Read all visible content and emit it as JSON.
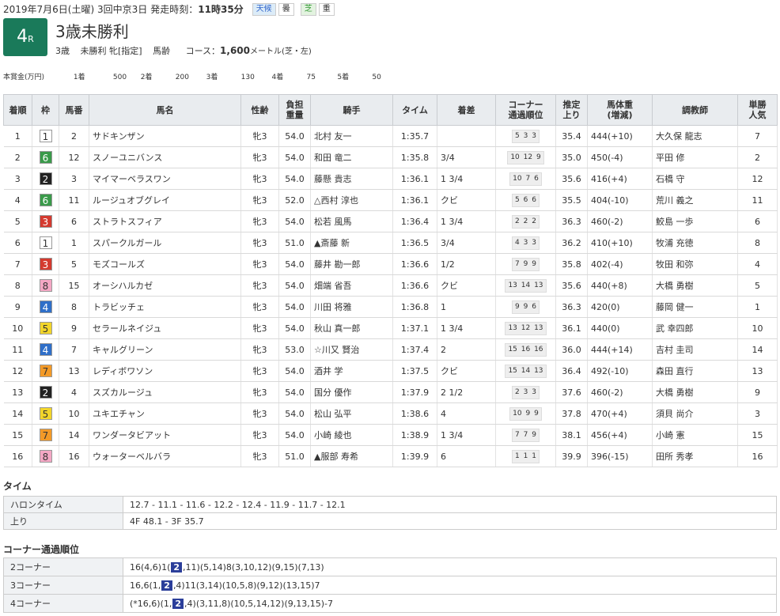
{
  "header": {
    "date": "2019年7月6日(土曜) 3回中京3日",
    "post_time_label": "発走時刻：",
    "post_time": "11時35分",
    "weather_label": "天候",
    "weather": "曇",
    "track_label": "芝",
    "track": "重"
  },
  "race": {
    "number": "4",
    "number_suffix": "R",
    "name": "3歳未勝利",
    "conditions": [
      "3歳",
      "未勝利 牝[指定]",
      "馬齢"
    ],
    "course_prefix": "コース：",
    "course_distance": "1,600",
    "course_suffix": "メートル(芝・左)"
  },
  "prize": {
    "label": "本賞金(万円)",
    "items": [
      {
        "place": "1着",
        "amount": "500"
      },
      {
        "place": "2着",
        "amount": "200"
      },
      {
        "place": "3着",
        "amount": "130"
      },
      {
        "place": "4着",
        "amount": "75"
      },
      {
        "place": "5着",
        "amount": "50"
      }
    ]
  },
  "columns": [
    "着順",
    "枠",
    "馬番",
    "馬名",
    "性齢",
    "負担\n重量",
    "騎手",
    "タイム",
    "着差",
    "コーナー\n通過順位",
    "推定\n上り",
    "馬体重\n(増減)",
    "調教師",
    "単勝\n人気"
  ],
  "waku_colors": {
    "1": {
      "bg": "#ffffff",
      "fg": "#333333"
    },
    "2": {
      "bg": "#222222",
      "fg": "#ffffff"
    },
    "3": {
      "bg": "#d43a2f",
      "fg": "#ffffff"
    },
    "4": {
      "bg": "#2f6fc8",
      "fg": "#ffffff"
    },
    "5": {
      "bg": "#f2d52a",
      "fg": "#333333"
    },
    "6": {
      "bg": "#3a9a4a",
      "fg": "#ffffff"
    },
    "7": {
      "bg": "#f39a28",
      "fg": "#333333"
    },
    "8": {
      "bg": "#f4a7c4",
      "fg": "#333333"
    }
  },
  "results": [
    {
      "rank": "1",
      "waku": "1",
      "num": "2",
      "horse": "サドキンザン",
      "sex_age": "牝3",
      "weight": "54.0",
      "jockey": "北村 友一",
      "time": "1:35.7",
      "margin": "",
      "corner": "5 3 3",
      "last3f": "35.4",
      "body": "444(+10)",
      "trainer": "大久保 龍志",
      "pop": "7"
    },
    {
      "rank": "2",
      "waku": "6",
      "num": "12",
      "horse": "スノーユニバンス",
      "sex_age": "牝3",
      "weight": "54.0",
      "jockey": "和田 竜二",
      "time": "1:35.8",
      "margin": "3/4",
      "corner": "10 12 9",
      "last3f": "35.0",
      "body": "450(-4)",
      "trainer": "平田 修",
      "pop": "2"
    },
    {
      "rank": "3",
      "waku": "2",
      "num": "3",
      "horse": "マイマーベラスワン",
      "sex_age": "牝3",
      "weight": "54.0",
      "jockey": "藤懸 貴志",
      "time": "1:36.1",
      "margin": "1 3/4",
      "corner": "10 7 6",
      "last3f": "35.6",
      "body": "416(+4)",
      "trainer": "石橋 守",
      "pop": "12"
    },
    {
      "rank": "4",
      "waku": "6",
      "num": "11",
      "horse": "ルージュオブグレイ",
      "sex_age": "牝3",
      "weight": "52.0",
      "jockey": "△西村 淳也",
      "time": "1:36.1",
      "margin": "クビ",
      "corner": "5 6 6",
      "last3f": "35.5",
      "body": "404(-10)",
      "trainer": "荒川 義之",
      "pop": "11"
    },
    {
      "rank": "5",
      "waku": "3",
      "num": "6",
      "horse": "ストラトスフィア",
      "sex_age": "牝3",
      "weight": "54.0",
      "jockey": "松若 風馬",
      "time": "1:36.4",
      "margin": "1 3/4",
      "corner": "2 2 2",
      "last3f": "36.3",
      "body": "460(-2)",
      "trainer": "鮫島 一歩",
      "pop": "6"
    },
    {
      "rank": "6",
      "waku": "1",
      "num": "1",
      "horse": "スパークルガール",
      "sex_age": "牝3",
      "weight": "51.0",
      "jockey": "▲斎藤 新",
      "time": "1:36.5",
      "margin": "3/4",
      "corner": "4 3 3",
      "last3f": "36.2",
      "body": "410(+10)",
      "trainer": "牧浦 充徳",
      "pop": "8"
    },
    {
      "rank": "7",
      "waku": "3",
      "num": "5",
      "horse": "モズコールズ",
      "sex_age": "牝3",
      "weight": "54.0",
      "jockey": "藤井 勘一郎",
      "time": "1:36.6",
      "margin": "1/2",
      "corner": "7 9 9",
      "last3f": "35.8",
      "body": "402(-4)",
      "trainer": "牧田 和弥",
      "pop": "4"
    },
    {
      "rank": "8",
      "waku": "8",
      "num": "15",
      "horse": "オーシハルカゼ",
      "sex_age": "牝3",
      "weight": "54.0",
      "jockey": "畑端 省吾",
      "time": "1:36.6",
      "margin": "クビ",
      "corner": "13 14 13",
      "last3f": "35.6",
      "body": "440(+8)",
      "trainer": "大橋 勇樹",
      "pop": "5"
    },
    {
      "rank": "9",
      "waku": "4",
      "num": "8",
      "horse": "トラビッチェ",
      "sex_age": "牝3",
      "weight": "54.0",
      "jockey": "川田 将雅",
      "time": "1:36.8",
      "margin": "1",
      "corner": "9 9 6",
      "last3f": "36.3",
      "body": "420(0)",
      "trainer": "藤岡 健一",
      "pop": "1"
    },
    {
      "rank": "10",
      "waku": "5",
      "num": "9",
      "horse": "セラールネイジュ",
      "sex_age": "牝3",
      "weight": "54.0",
      "jockey": "秋山 真一郎",
      "time": "1:37.1",
      "margin": "1 3/4",
      "corner": "13 12 13",
      "last3f": "36.1",
      "body": "440(0)",
      "trainer": "武 幸四郎",
      "pop": "10"
    },
    {
      "rank": "11",
      "waku": "4",
      "num": "7",
      "horse": "キャルグリーン",
      "sex_age": "牝3",
      "weight": "53.0",
      "jockey": "☆川又 賢治",
      "time": "1:37.4",
      "margin": "2",
      "corner": "15 16 16",
      "last3f": "36.0",
      "body": "444(+14)",
      "trainer": "吉村 圭司",
      "pop": "14"
    },
    {
      "rank": "12",
      "waku": "7",
      "num": "13",
      "horse": "レディボワソン",
      "sex_age": "牝3",
      "weight": "54.0",
      "jockey": "酒井 学",
      "time": "1:37.5",
      "margin": "クビ",
      "corner": "15 14 13",
      "last3f": "36.4",
      "body": "492(-10)",
      "trainer": "森田 直行",
      "pop": "13"
    },
    {
      "rank": "13",
      "waku": "2",
      "num": "4",
      "horse": "スズカルージュ",
      "sex_age": "牝3",
      "weight": "54.0",
      "jockey": "国分 優作",
      "time": "1:37.9",
      "margin": "2 1/2",
      "corner": "2 3 3",
      "last3f": "37.6",
      "body": "460(-2)",
      "trainer": "大橋 勇樹",
      "pop": "9"
    },
    {
      "rank": "14",
      "waku": "5",
      "num": "10",
      "horse": "ユキエチャン",
      "sex_age": "牝3",
      "weight": "54.0",
      "jockey": "松山 弘平",
      "time": "1:38.6",
      "margin": "4",
      "corner": "10 9 9",
      "last3f": "37.8",
      "body": "470(+4)",
      "trainer": "須貝 尚介",
      "pop": "3"
    },
    {
      "rank": "15",
      "waku": "7",
      "num": "14",
      "horse": "ワンダータビアット",
      "sex_age": "牝3",
      "weight": "54.0",
      "jockey": "小崎 綾也",
      "time": "1:38.9",
      "margin": "1 3/4",
      "corner": "7 7 9",
      "last3f": "38.1",
      "body": "456(+4)",
      "trainer": "小崎 憲",
      "pop": "15"
    },
    {
      "rank": "16",
      "waku": "8",
      "num": "16",
      "horse": "ウォーターベルバラ",
      "sex_age": "牝3",
      "weight": "51.0",
      "jockey": "▲服部 寿希",
      "time": "1:39.9",
      "margin": "6",
      "corner": "1 1 1",
      "last3f": "39.9",
      "body": "396(-15)",
      "trainer": "田所 秀孝",
      "pop": "16"
    }
  ],
  "time_section": {
    "title": "タイム",
    "rows": [
      {
        "label": "ハロンタイム",
        "value": "12.7 - 11.1 - 11.6 - 12.2 - 12.4 - 11.9 - 11.7 - 12.1"
      },
      {
        "label": "上り",
        "value": "4F 48.1 - 3F 35.7"
      }
    ]
  },
  "corner_section": {
    "title": "コーナー通過順位",
    "rows": [
      {
        "label": "2コーナー",
        "before": "16(4,6)1(",
        "hl": "2",
        "after": ",11)(5,14)8(3,10,12)(9,15)(7,13)"
      },
      {
        "label": "3コーナー",
        "before": "16,6(1,",
        "hl": "2",
        "after": ",4)11(3,14)(10,5,8)(9,12)(13,15)7"
      },
      {
        "label": "4コーナー",
        "before": "(*16,6)(1,",
        "hl": "2",
        "after": ",4)(3,11,8)(10,5,14,12)(9,13,15)-7"
      }
    ]
  }
}
